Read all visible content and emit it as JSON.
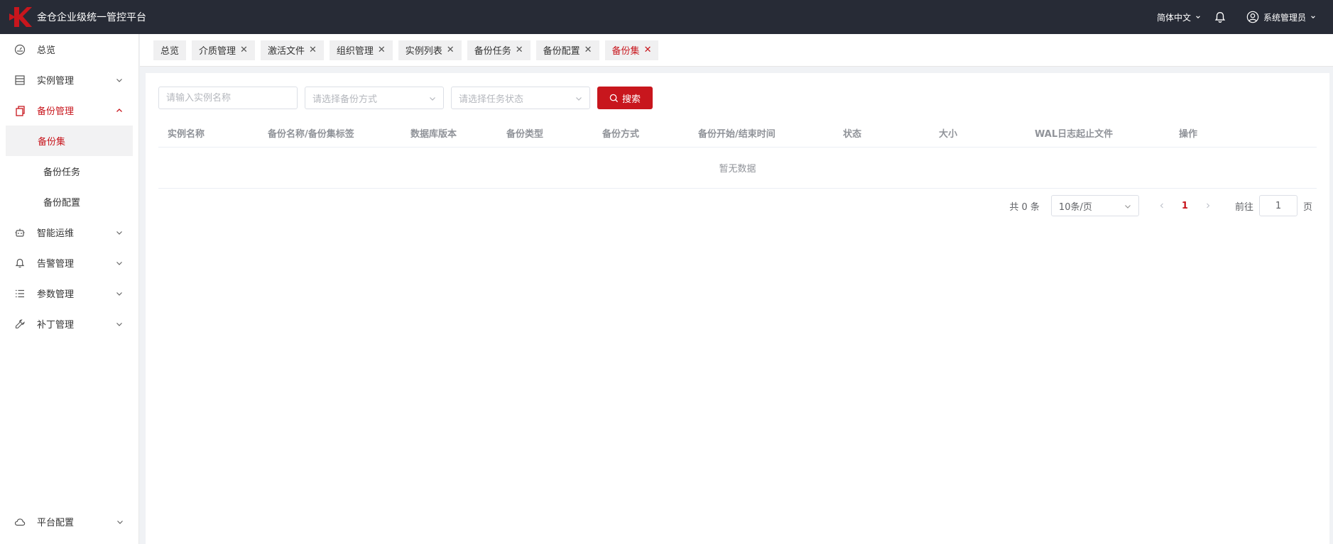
{
  "app": {
    "title": "金仓企业级统一管控平台",
    "accent": "#c8161d",
    "header_bg": "#272b36"
  },
  "header": {
    "language": "简体中文",
    "user": "系统管理员"
  },
  "sidebar": {
    "items": [
      {
        "label": "总览",
        "icon": "dashboard-icon"
      },
      {
        "label": "实例管理",
        "icon": "database-icon"
      },
      {
        "label": "备份管理",
        "icon": "copy-icon"
      },
      {
        "label": "智能运维",
        "icon": "robot-icon"
      },
      {
        "label": "告警管理",
        "icon": "bell-icon"
      },
      {
        "label": "参数管理",
        "icon": "list-icon"
      },
      {
        "label": "补丁管理",
        "icon": "wrench-icon"
      }
    ],
    "subitems": [
      "备份集",
      "备份任务",
      "备份配置"
    ],
    "bottom": {
      "label": "平台配置",
      "icon": "cloud-icon"
    }
  },
  "tabs": [
    {
      "label": "总览"
    },
    {
      "label": "介质管理"
    },
    {
      "label": "激活文件"
    },
    {
      "label": "组织管理"
    },
    {
      "label": "实例列表"
    },
    {
      "label": "备份任务"
    },
    {
      "label": "备份配置"
    },
    {
      "label": "备份集"
    }
  ],
  "filters": {
    "instance_placeholder": "请输入实例名称",
    "backup_method_placeholder": "请选择备份方式",
    "task_status_placeholder": "请选择任务状态",
    "search_label": "搜索"
  },
  "table": {
    "columns": [
      "实例名称",
      "备份名称/备份集标签",
      "数据库版本",
      "备份类型",
      "备份方式",
      "备份开始/结束时间",
      "状态",
      "大小",
      "WAL日志起止文件",
      "操作"
    ],
    "empty_text": "暂无数据"
  },
  "pagination": {
    "total": "共 0 条",
    "page_size": "10条/页",
    "current_page": "1",
    "goto_label": "前往",
    "goto_value": "1",
    "page_suffix": "页"
  }
}
